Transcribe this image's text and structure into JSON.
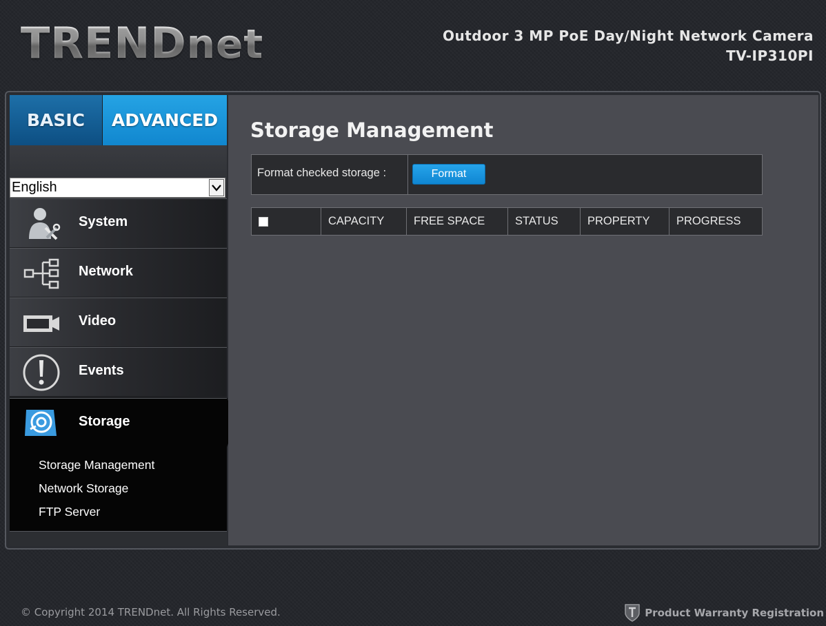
{
  "header": {
    "brand_main": "TREND",
    "brand_suffix": "net",
    "product_title": "Outdoor 3 MP PoE Day/Night Network Camera",
    "model": "TV-IP310PI"
  },
  "tabs": {
    "basic": "BASIC",
    "advanced": "ADVANCED"
  },
  "language": {
    "selected": "English"
  },
  "menu": {
    "system": "System",
    "network": "Network",
    "video": "Video",
    "events": "Events",
    "storage": "Storage",
    "storage_sub": [
      "Storage Management",
      "Network Storage",
      "FTP Server"
    ]
  },
  "main": {
    "title": "Storage Management",
    "format_label": "Format checked storage :",
    "format_button": "Format",
    "table_headers": [
      "CAPACITY",
      "FREE SPACE",
      "STATUS",
      "PROPERTY",
      "PROGRESS"
    ]
  },
  "footer": {
    "copyright": "© Copyright 2014 TRENDnet. All Rights Reserved.",
    "warranty": "Product Warranty Registration"
  },
  "colors": {
    "accent_blue": "#1187cf",
    "basic_tab": "#0d4f83",
    "content_bg": "#4a4b51"
  },
  "icons": [
    "system-tools-icon",
    "network-tree-icon",
    "video-camera-icon",
    "events-alert-icon",
    "storage-disk-icon",
    "warranty-shield-icon"
  ]
}
